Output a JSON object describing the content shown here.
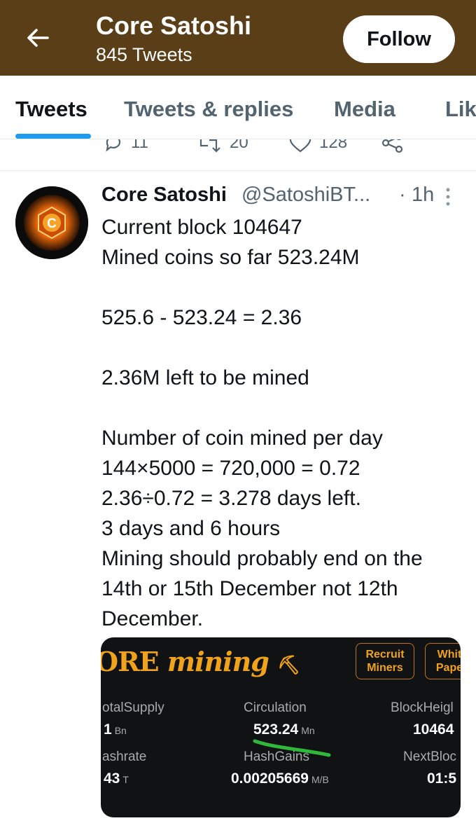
{
  "header": {
    "name": "Core Satoshi",
    "tweet_count": "845 Tweets",
    "follow_label": "Follow",
    "background": "#5a3e17"
  },
  "tabs": [
    {
      "label": "Tweets",
      "active": true
    },
    {
      "label": "Tweets & replies",
      "active": false
    },
    {
      "label": "Media",
      "active": false
    },
    {
      "label": "Lik",
      "active": false
    }
  ],
  "prev_tweet_actions": {
    "replies": "11",
    "retweets": "20",
    "likes": "128"
  },
  "tweet": {
    "author_name": "Core Satoshi",
    "handle": "@SatoshiBT...",
    "dot": "·",
    "time": "1h",
    "lines": [
      "Current block 104647",
      "Mined coins so far 523.24M",
      "",
      "525.6 - 523.24 = 2.36",
      "",
      "2.36M left to be mined",
      "",
      "Number of coin mined per day",
      "144×5000 = 720,000 = 0.72",
      "2.36÷0.72 = 3.278 days left.",
      "3 days and 6 hours",
      "Mining should probably end on the",
      "14th or 15th December not 12th",
      "December."
    ],
    "avatar_letter": "C"
  },
  "media": {
    "title_core": "ORE",
    "title_mining": "mining",
    "button_recruit": [
      "Recruit",
      "Miners"
    ],
    "button_white": [
      "Whit",
      "Pape"
    ],
    "stats": {
      "total_supply_label": "otalSupply",
      "total_supply_value": "1",
      "total_supply_unit": "Bn",
      "circulation_label": "Circulation",
      "circulation_value": "523.24",
      "circulation_unit": "Mn",
      "block_height_label": "BlockHeigl",
      "block_height_value": "10464",
      "hashrate_label": "ashrate",
      "hashrate_value": "43",
      "hashrate_unit": "T",
      "hash_gains_label": "HashGains",
      "hash_gains_value": "0.00205669",
      "hash_gains_unit": "M/B",
      "next_block_label": "NextBloc",
      "next_block_value": "01:5"
    }
  },
  "colors": {
    "accent": "#1d9bf0",
    "muted": "#536471",
    "media_orange": "#f0a21b",
    "highlight_green": "#2fb83a"
  }
}
